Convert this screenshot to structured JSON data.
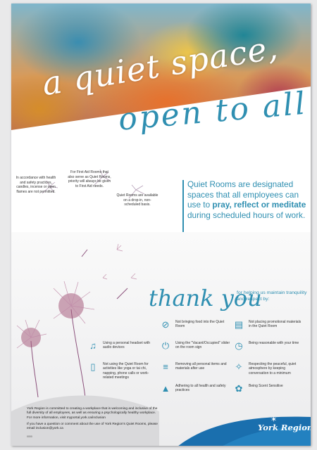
{
  "header": {
    "line1": "a quiet space,",
    "line2": "open to all"
  },
  "rules": [
    {
      "text": "In accordance with health and safety practices, candles, incense or open flames are not permitted."
    },
    {
      "text": "For First Aid Rooms that also serve as Quiet Rooms, priority will always be given to First Aid needs."
    },
    {
      "text": "Quiet Rooms are available on a drop-in, non-scheduled basis."
    }
  ],
  "intro": {
    "part1": "Quiet Rooms are designated spaces that all employees can use to ",
    "emphasis1": "pray, reflect or meditate",
    "part2": " during scheduled hours of work."
  },
  "thanks": {
    "title": "thank you",
    "subtitle": "for helping us maintain tranquility and respect by:"
  },
  "items": [
    {
      "icon": "no-food-icon",
      "glyph": "⊘",
      "text": "Not bringing food into the Quiet Room"
    },
    {
      "icon": "no-promotion-icon",
      "glyph": "▤",
      "text": "Not placing promotional materials in the Quiet Room"
    },
    {
      "icon": "headset-icon",
      "glyph": "♫",
      "text": "Using a personal headset with audio devices"
    },
    {
      "icon": "power-icon",
      "glyph": "⏻",
      "text": "Using the \"Vacant/Occupied\" slider on the room sign"
    },
    {
      "icon": "clock-icon",
      "glyph": "◷",
      "text": "Being reasonable with your time"
    },
    {
      "icon": "no-phone-icon",
      "glyph": "▯",
      "text": "Not using the Quiet Room for activities like yoga or tai chi, napping, phone calls or work-related meetings"
    },
    {
      "icon": "items-icon",
      "glyph": "≡",
      "text": "Removing all personal items and materials after use"
    },
    {
      "icon": "respect-icon",
      "glyph": "✧",
      "text": "Respecting the peaceful, quiet atmosphere by keeping conversation to a minimum"
    },
    {
      "icon": "warning-icon",
      "glyph": "▲",
      "text": "Adhering to all health and safety practices"
    },
    {
      "icon": "scent-icon",
      "glyph": "✿",
      "text": "Being Scent Sensitive"
    }
  ],
  "footer": {
    "p1": "York Region is committed to creating a workplace that is welcoming and inclusive of the full diversity of all employees, as well as ensuring a psychologically healthy workplace. For more information, visit myportal.york.ca/inclusion",
    "p2": "If you have a question or comment about the use of York Region's Quiet Rooms, please email inclusion@york.ca",
    "code": "0000"
  },
  "brand": {
    "name": "York Region"
  },
  "colors": {
    "accent": "#2f8fb1",
    "bottom_band": "#1a6fae"
  }
}
